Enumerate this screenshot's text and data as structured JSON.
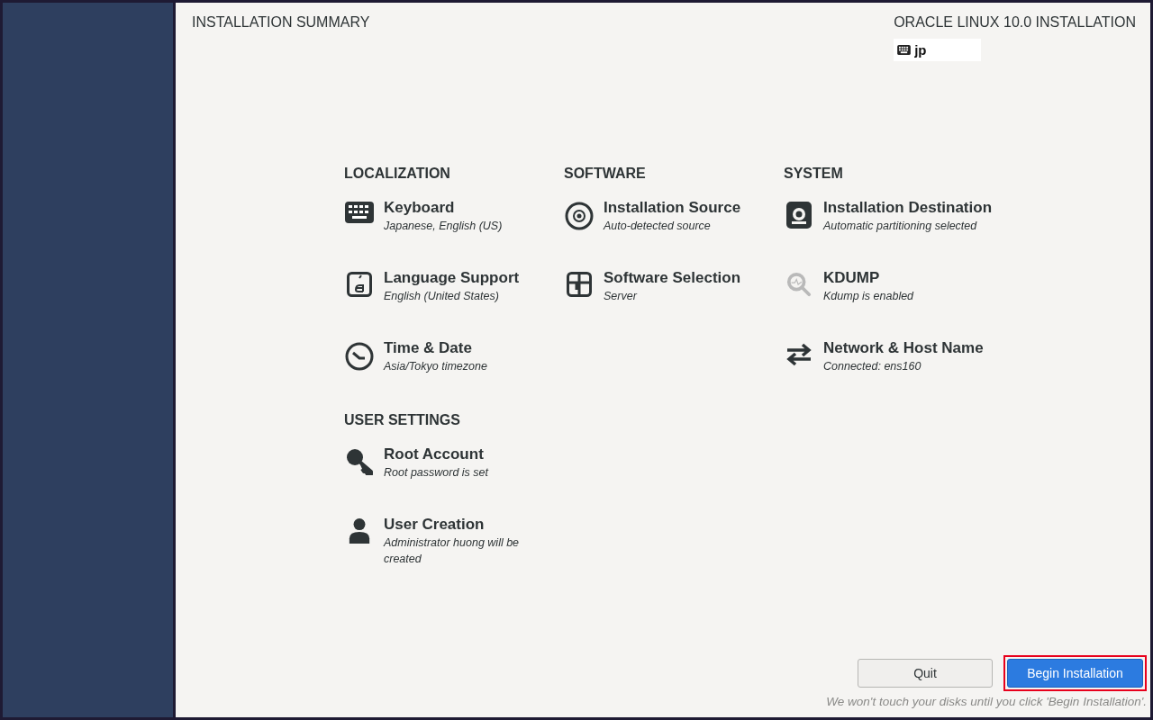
{
  "header": {
    "title": "INSTALLATION SUMMARY",
    "product": "ORACLE LINUX 10.0 INSTALLATION",
    "keyboard_layout": "jp"
  },
  "categories": [
    {
      "title": "LOCALIZATION",
      "spokes": [
        {
          "kind": "keyboard",
          "title": "Keyboard",
          "status": "Japanese, English (US)"
        },
        {
          "kind": "language",
          "title": "Language Support",
          "status": "English (United States)"
        },
        {
          "kind": "clock",
          "title": "Time & Date",
          "status": "Asia/Tokyo timezone"
        }
      ]
    },
    {
      "title": "SOFTWARE",
      "spokes": [
        {
          "kind": "disc",
          "title": "Installation Source",
          "status": "Auto-detected source"
        },
        {
          "kind": "package",
          "title": "Software Selection",
          "status": "Server"
        }
      ]
    },
    {
      "title": "SYSTEM",
      "spokes": [
        {
          "kind": "drive",
          "title": "Installation Destination",
          "status": "Automatic partitioning selected"
        },
        {
          "kind": "magnifier",
          "title": "KDUMP",
          "status": "Kdump is enabled"
        },
        {
          "kind": "network",
          "title": "Network & Host Name",
          "status": "Connected: ens160"
        }
      ]
    },
    {
      "title": "USER SETTINGS",
      "spokes": [
        {
          "kind": "key",
          "title": "Root Account",
          "status": "Root password is set"
        },
        {
          "kind": "user",
          "title": "User Creation",
          "status": "Administrator huong will be created"
        }
      ]
    }
  ],
  "buttons": [
    {
      "label": "Quit",
      "kind": "secondary",
      "highlighted": false
    },
    {
      "label": "Begin Installation",
      "kind": "primary",
      "highlighted": true
    }
  ],
  "footer_note": "We won't touch your disks until you click 'Begin Installation'."
}
